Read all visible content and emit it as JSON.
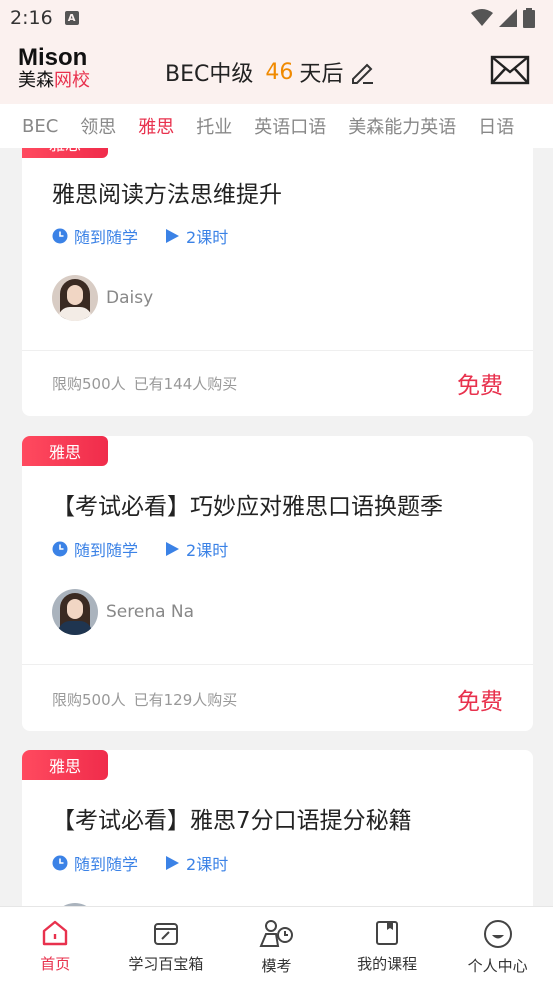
{
  "status_bar": {
    "time": "2:16",
    "notification_icon": "A"
  },
  "header": {
    "logo": {
      "line1": "Mison",
      "line2_a": "美森",
      "line2_b": "网校"
    },
    "exam_name": "BEC中级",
    "days": "46",
    "days_suffix": "天后"
  },
  "tabs": [
    "BEC",
    "领思",
    "雅思",
    "托业",
    "英语口语",
    "美森能力英语",
    "日语"
  ],
  "active_tab": "雅思",
  "courses": [
    {
      "badge": "雅思",
      "title": "雅思阅读方法思维提升",
      "schedule": "随到随学",
      "lessons": "2课时",
      "teacher": "Daisy",
      "limit": "限购500人",
      "bought": "已有144人购买",
      "price": "免费"
    },
    {
      "badge": "雅思",
      "title": "【考试必看】巧妙应对雅思口语换题季",
      "schedule": "随到随学",
      "lessons": "2课时",
      "teacher": "Serena Na",
      "limit": "限购500人",
      "bought": "已有129人购买",
      "price": "免费"
    },
    {
      "badge": "雅思",
      "title": "【考试必看】雅思7分口语提分秘籍",
      "schedule": "随到随学",
      "lessons": "2课时"
    }
  ],
  "bottom_nav": [
    {
      "label": "首页",
      "icon": "home-icon"
    },
    {
      "label": "学习百宝箱",
      "icon": "toolbox-icon"
    },
    {
      "label": "模考",
      "icon": "mock-exam-icon"
    },
    {
      "label": "我的课程",
      "icon": "my-course-icon"
    },
    {
      "label": "个人中心",
      "icon": "profile-icon"
    }
  ],
  "colors": {
    "accent": "#e8314d",
    "countdown": "#f08a00",
    "link": "#3b82e6"
  }
}
